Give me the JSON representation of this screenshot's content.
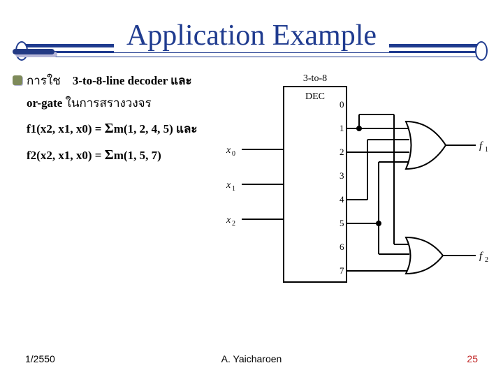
{
  "title": "Application Example",
  "body": {
    "line1a": "การใช",
    "line1b": "3-to-8-line decoder  และ",
    "line2a": "or-gate",
    "line2b": "ในการสรางวงจร",
    "f1_lhs": "f1(x2, x1, x0) = ",
    "f1_rhs": "m(1, 2, 4, 5) และ",
    "f2_lhs": "f2(x2, x1, x0) = ",
    "f2_rhs": "m(1, 5, 7)"
  },
  "diagram": {
    "block_label_top": "3-to-8",
    "block_label_bot": "DEC",
    "inputs": [
      "x0",
      "x1",
      "x2"
    ],
    "outputs": [
      "0",
      "1",
      "2",
      "3",
      "4",
      "5",
      "6",
      "7"
    ],
    "gate_out1": "f1",
    "gate_out2": "f2"
  },
  "footer": {
    "left": "1/2550",
    "center": "A. Yaicharoen",
    "right": "25"
  }
}
